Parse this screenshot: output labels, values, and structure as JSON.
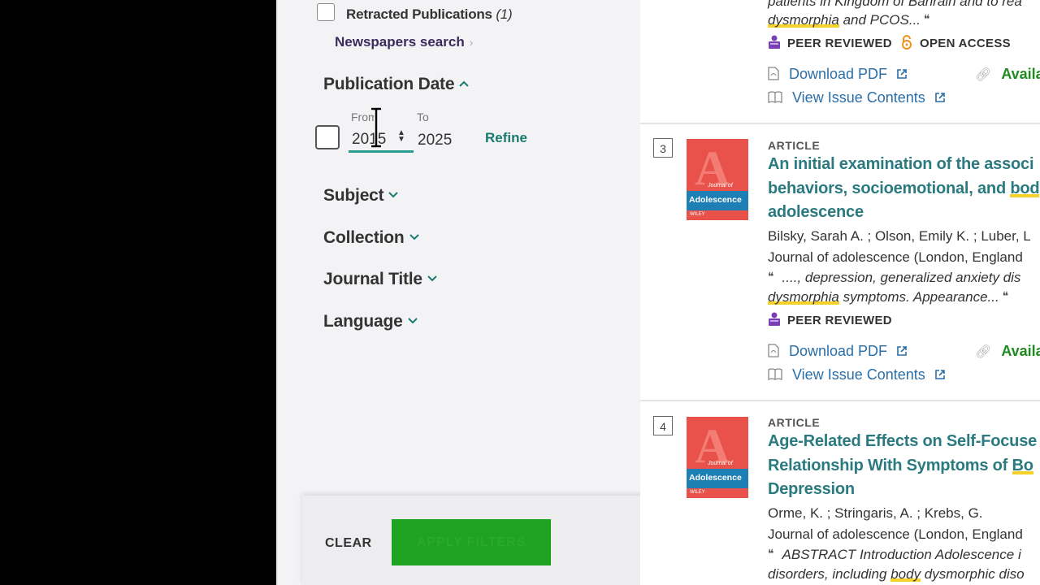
{
  "sidebar": {
    "retracted": {
      "label": "Retracted Publications",
      "count": "(1)"
    },
    "newspapers_link": "Newspapers search",
    "publication_date": {
      "title": "Publication Date",
      "from_label": "From",
      "to_label": "To",
      "from_value": "2015",
      "to_value": "2025",
      "refine": "Refine"
    },
    "facets": [
      "Subject",
      "Collection",
      "Journal Title",
      "Language"
    ],
    "footer": {
      "clear": "CLEAR",
      "apply": "APPLY FILTERS"
    }
  },
  "results": {
    "top": {
      "snippet_line1": "patients in Kingdom of Bahrain and to rea",
      "snippet_line2_hl": "dysmorphia",
      "snippet_line2_rest": " and PCOS...",
      "peer_reviewed": "PEER REVIEWED",
      "open_access": "OPEN ACCESS",
      "download_pdf": "Download PDF",
      "available": "Availab",
      "view_issue": "View Issue Contents"
    },
    "items": [
      {
        "number": "3",
        "type": "ARTICLE",
        "cover_title": "Adolescence",
        "title_line1": "An initial examination of the associ",
        "title_line2_pre": "behaviors, socioemotional, and ",
        "title_line2_hl": "bod",
        "title_line3": "adolescence",
        "authors": "Bilsky, Sarah A. ; Olson, Emily K. ; Luber, L",
        "journal": "Journal of adolescence (London, England",
        "snippet_line1": "...., depression, generalized anxiety dis",
        "snippet_line2_hl": "dysmorphia",
        "snippet_line2_rest": " symptoms. Appearance...",
        "peer_reviewed": "PEER REVIEWED",
        "download_pdf": "Download PDF",
        "available": "Availab",
        "view_issue": "View Issue Contents"
      },
      {
        "number": "4",
        "type": "ARTICLE",
        "cover_title": "Adolescence",
        "title_line1": "Age-Related Effects on Self-Focuse",
        "title_line2_pre": "Relationship With Symptoms of ",
        "title_line2_hl": "Bo",
        "title_line3": "Depression",
        "authors": "Orme, K. ; Stringaris, A. ; Krebs, G.",
        "journal": "Journal of adolescence (London, England",
        "snippet_line1": "ABSTRACT Introduction Adolescence i",
        "snippet_line2_pre": "disorders, including ",
        "snippet_line2_hl": "body",
        "snippet_line2_rest": " dysmorphic diso"
      }
    ]
  },
  "icons": {
    "peer_reviewed": "book-stack-icon",
    "open_access": "open-lock-icon",
    "pdf": "pdf-file-icon",
    "external": "external-link-icon",
    "book": "open-book-icon",
    "link": "chain-link-icon"
  },
  "colors": {
    "accent": "#1a7a6e",
    "apply": "#1fa21f",
    "link": "#2a6fa8",
    "available": "#1f8a1f",
    "highlight": "#f5d22a"
  }
}
